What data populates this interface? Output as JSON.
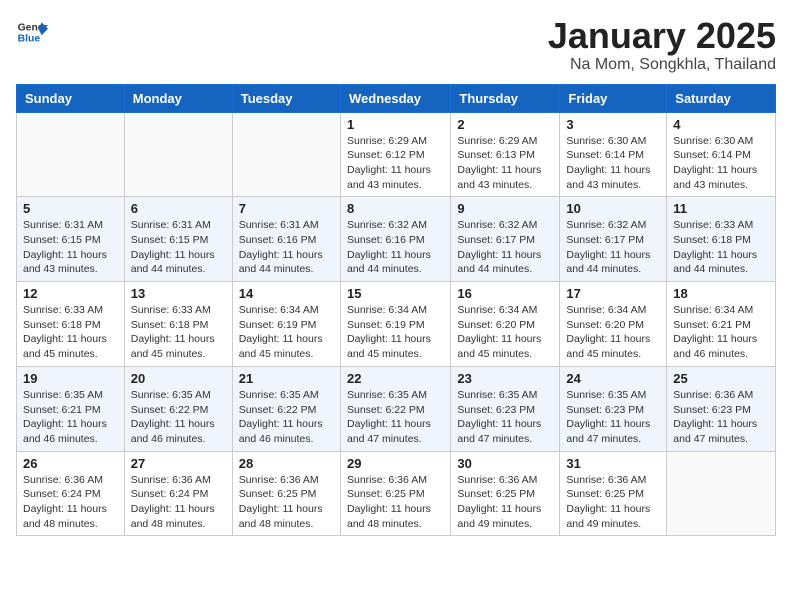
{
  "header": {
    "logo_general": "General",
    "logo_blue": "Blue",
    "month_title": "January 2025",
    "location": "Na Mom, Songkhla, Thailand"
  },
  "days_of_week": [
    "Sunday",
    "Monday",
    "Tuesday",
    "Wednesday",
    "Thursday",
    "Friday",
    "Saturday"
  ],
  "weeks": [
    [
      {
        "day": "",
        "info": ""
      },
      {
        "day": "",
        "info": ""
      },
      {
        "day": "",
        "info": ""
      },
      {
        "day": "1",
        "info": "Sunrise: 6:29 AM\nSunset: 6:12 PM\nDaylight: 11 hours and 43 minutes."
      },
      {
        "day": "2",
        "info": "Sunrise: 6:29 AM\nSunset: 6:13 PM\nDaylight: 11 hours and 43 minutes."
      },
      {
        "day": "3",
        "info": "Sunrise: 6:30 AM\nSunset: 6:14 PM\nDaylight: 11 hours and 43 minutes."
      },
      {
        "day": "4",
        "info": "Sunrise: 6:30 AM\nSunset: 6:14 PM\nDaylight: 11 hours and 43 minutes."
      }
    ],
    [
      {
        "day": "5",
        "info": "Sunrise: 6:31 AM\nSunset: 6:15 PM\nDaylight: 11 hours and 43 minutes."
      },
      {
        "day": "6",
        "info": "Sunrise: 6:31 AM\nSunset: 6:15 PM\nDaylight: 11 hours and 44 minutes."
      },
      {
        "day": "7",
        "info": "Sunrise: 6:31 AM\nSunset: 6:16 PM\nDaylight: 11 hours and 44 minutes."
      },
      {
        "day": "8",
        "info": "Sunrise: 6:32 AM\nSunset: 6:16 PM\nDaylight: 11 hours and 44 minutes."
      },
      {
        "day": "9",
        "info": "Sunrise: 6:32 AM\nSunset: 6:17 PM\nDaylight: 11 hours and 44 minutes."
      },
      {
        "day": "10",
        "info": "Sunrise: 6:32 AM\nSunset: 6:17 PM\nDaylight: 11 hours and 44 minutes."
      },
      {
        "day": "11",
        "info": "Sunrise: 6:33 AM\nSunset: 6:18 PM\nDaylight: 11 hours and 44 minutes."
      }
    ],
    [
      {
        "day": "12",
        "info": "Sunrise: 6:33 AM\nSunset: 6:18 PM\nDaylight: 11 hours and 45 minutes."
      },
      {
        "day": "13",
        "info": "Sunrise: 6:33 AM\nSunset: 6:18 PM\nDaylight: 11 hours and 45 minutes."
      },
      {
        "day": "14",
        "info": "Sunrise: 6:34 AM\nSunset: 6:19 PM\nDaylight: 11 hours and 45 minutes."
      },
      {
        "day": "15",
        "info": "Sunrise: 6:34 AM\nSunset: 6:19 PM\nDaylight: 11 hours and 45 minutes."
      },
      {
        "day": "16",
        "info": "Sunrise: 6:34 AM\nSunset: 6:20 PM\nDaylight: 11 hours and 45 minutes."
      },
      {
        "day": "17",
        "info": "Sunrise: 6:34 AM\nSunset: 6:20 PM\nDaylight: 11 hours and 45 minutes."
      },
      {
        "day": "18",
        "info": "Sunrise: 6:34 AM\nSunset: 6:21 PM\nDaylight: 11 hours and 46 minutes."
      }
    ],
    [
      {
        "day": "19",
        "info": "Sunrise: 6:35 AM\nSunset: 6:21 PM\nDaylight: 11 hours and 46 minutes."
      },
      {
        "day": "20",
        "info": "Sunrise: 6:35 AM\nSunset: 6:22 PM\nDaylight: 11 hours and 46 minutes."
      },
      {
        "day": "21",
        "info": "Sunrise: 6:35 AM\nSunset: 6:22 PM\nDaylight: 11 hours and 46 minutes."
      },
      {
        "day": "22",
        "info": "Sunrise: 6:35 AM\nSunset: 6:22 PM\nDaylight: 11 hours and 47 minutes."
      },
      {
        "day": "23",
        "info": "Sunrise: 6:35 AM\nSunset: 6:23 PM\nDaylight: 11 hours and 47 minutes."
      },
      {
        "day": "24",
        "info": "Sunrise: 6:35 AM\nSunset: 6:23 PM\nDaylight: 11 hours and 47 minutes."
      },
      {
        "day": "25",
        "info": "Sunrise: 6:36 AM\nSunset: 6:23 PM\nDaylight: 11 hours and 47 minutes."
      }
    ],
    [
      {
        "day": "26",
        "info": "Sunrise: 6:36 AM\nSunset: 6:24 PM\nDaylight: 11 hours and 48 minutes."
      },
      {
        "day": "27",
        "info": "Sunrise: 6:36 AM\nSunset: 6:24 PM\nDaylight: 11 hours and 48 minutes."
      },
      {
        "day": "28",
        "info": "Sunrise: 6:36 AM\nSunset: 6:25 PM\nDaylight: 11 hours and 48 minutes."
      },
      {
        "day": "29",
        "info": "Sunrise: 6:36 AM\nSunset: 6:25 PM\nDaylight: 11 hours and 48 minutes."
      },
      {
        "day": "30",
        "info": "Sunrise: 6:36 AM\nSunset: 6:25 PM\nDaylight: 11 hours and 49 minutes."
      },
      {
        "day": "31",
        "info": "Sunrise: 6:36 AM\nSunset: 6:25 PM\nDaylight: 11 hours and 49 minutes."
      },
      {
        "day": "",
        "info": ""
      }
    ]
  ]
}
